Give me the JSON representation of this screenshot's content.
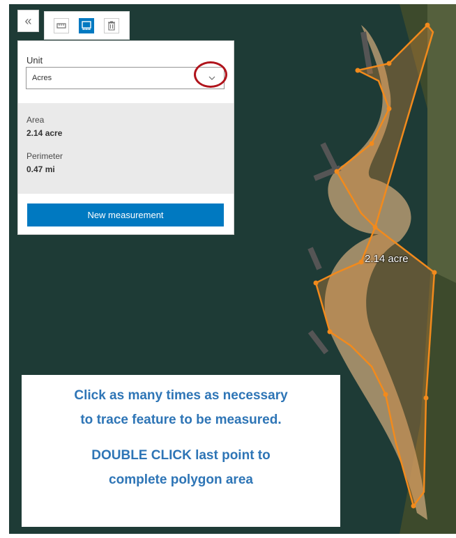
{
  "toolbar": {
    "collapse_icon": "double-chevron-left-icon",
    "tools": [
      {
        "name": "distance",
        "icon": "ruler-icon",
        "active": false
      },
      {
        "name": "area",
        "icon": "area-measure-icon",
        "active": true
      },
      {
        "name": "clear",
        "icon": "trash-icon",
        "active": false
      }
    ]
  },
  "panel": {
    "unit_label": "Unit",
    "unit_value": "Acres",
    "area_label": "Area",
    "area_value": "2.14 acre",
    "perimeter_label": "Perimeter",
    "perimeter_value": "0.47 mi",
    "new_measurement_label": "New measurement"
  },
  "map": {
    "measurement_label": "2.14 acre"
  },
  "instructions": {
    "line1": "Click as many times as necessary",
    "line2": "to trace feature to be measured.",
    "line3": "DOUBLE CLICK last point to",
    "line4": "complete polygon area"
  },
  "colors": {
    "accent": "#0079c1",
    "highlight_circle": "#b0141c",
    "polygon_stroke": "#f28a1c",
    "instruction_text": "#2e75b6"
  }
}
